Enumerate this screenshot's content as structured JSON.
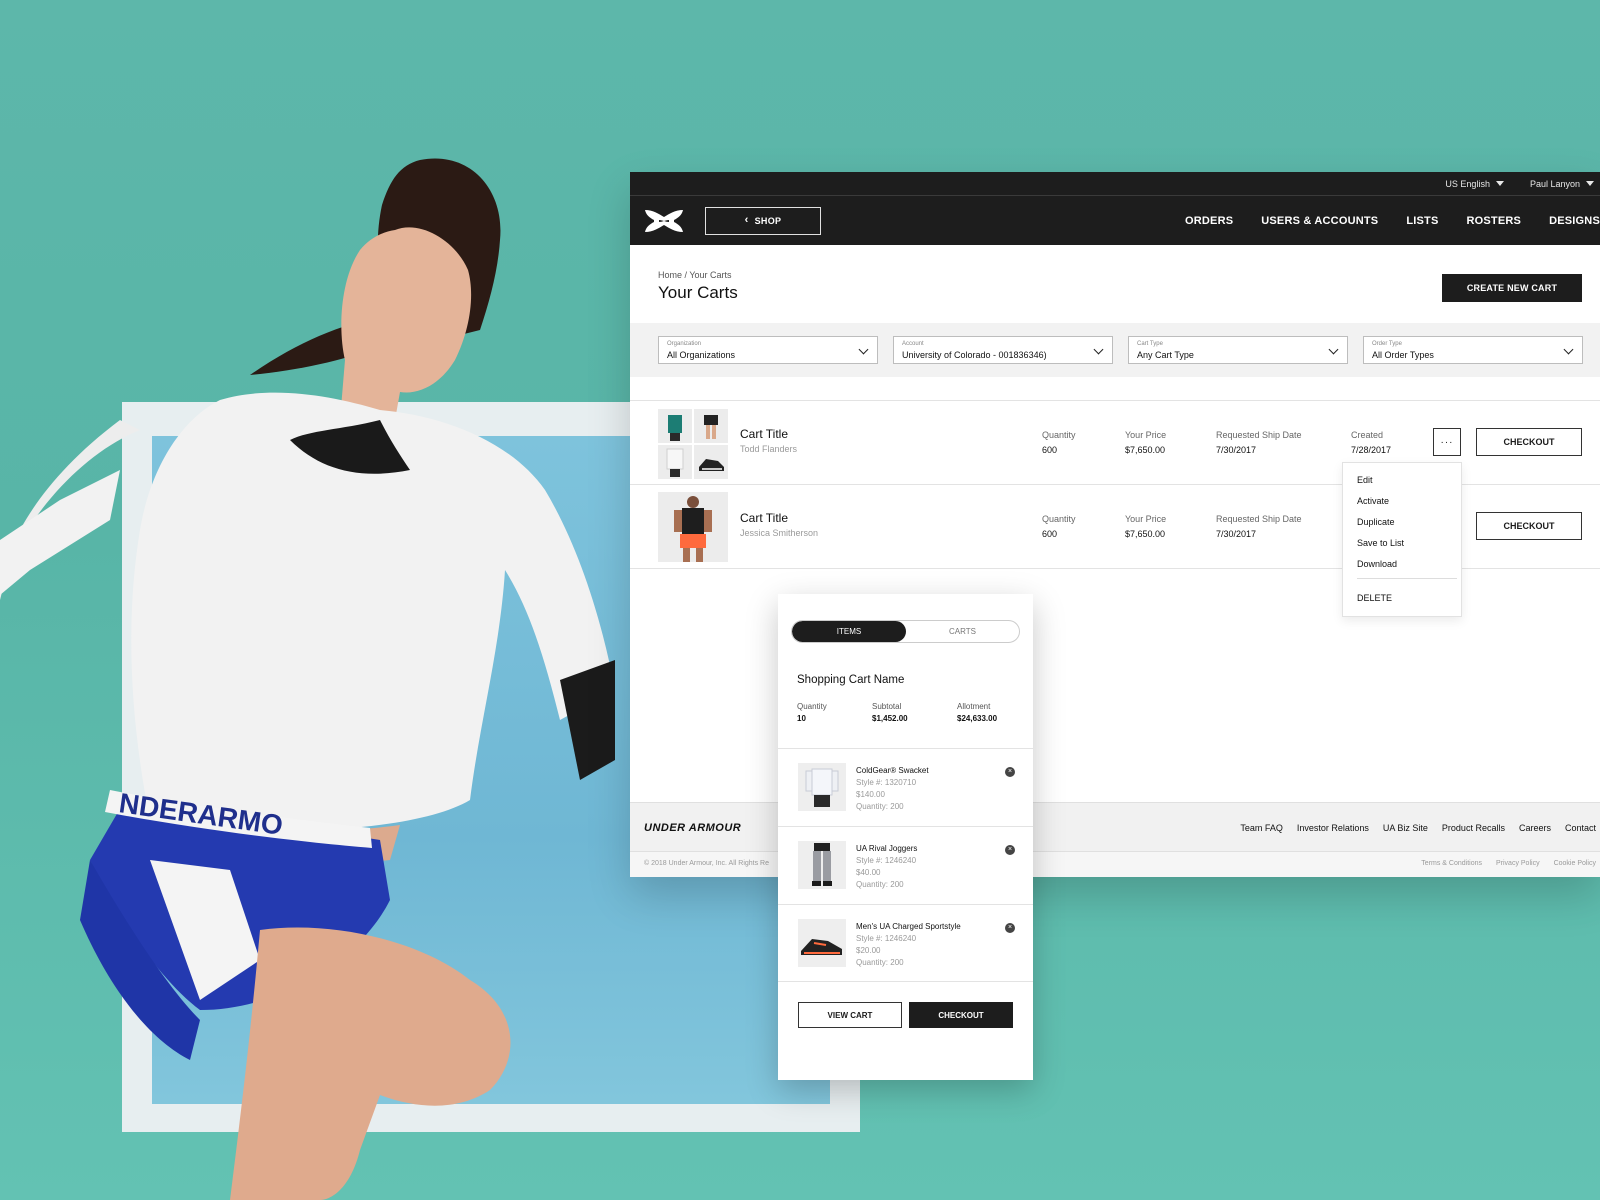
{
  "colors": {
    "background": "#5db7aa",
    "nav": "#1d1d1d",
    "accent_orange": "#ff6a3d",
    "brand_blue": "#2430a8"
  },
  "utility_bar": {
    "language": "US English",
    "user": "Paul Lanyon"
  },
  "nav": {
    "logo_icon": "under-armour-logo",
    "shop_label": "SHOP",
    "links": [
      "ORDERS",
      "USERS & ACCOUNTS",
      "LISTS",
      "ROSTERS",
      "DESIGNS"
    ]
  },
  "page": {
    "breadcrumb": "Home / Your Carts",
    "title": "Your Carts",
    "create_button": "CREATE NEW CART"
  },
  "filters": [
    {
      "label": "Organization",
      "value": "All Organizations"
    },
    {
      "label": "Account",
      "value": "University of Colorado - 001836346)"
    },
    {
      "label": "Cart Type",
      "value": "Any Cart Type"
    },
    {
      "label": "Order Type",
      "value": "All Order Types"
    }
  ],
  "carts": [
    {
      "title": "Cart Title",
      "owner": "Todd Flanders",
      "quantity_label": "Quantity",
      "quantity": "600",
      "price_label": "Your Price",
      "price": "$7,650.00",
      "ship_label": "Requested Ship Date",
      "ship_date": "7/30/2017",
      "created_label": "Created",
      "created": "7/28/2017",
      "more_label": "···",
      "checkout": "CHECKOUT"
    },
    {
      "title": "Cart Title",
      "owner": "Jessica Smitherson",
      "quantity_label": "Quantity",
      "quantity": "600",
      "price_label": "Your Price",
      "price": "$7,650.00",
      "ship_label": "Requested Ship Date",
      "ship_date": "7/30/2017",
      "checkout": "CHECKOUT"
    }
  ],
  "dropdown": [
    "Edit",
    "Activate",
    "Duplicate",
    "Save to List",
    "Download",
    "DELETE"
  ],
  "footer": {
    "logo_text": "UNDER ARMOUR",
    "links": [
      "Team FAQ",
      "Investor Relations",
      "UA Biz Site",
      "Product Recalls",
      "Careers",
      "Contact"
    ],
    "copyright": "© 2018 Under Armour, Inc. All Rights Re",
    "legal": [
      "Terms & Conditions",
      "Privacy Policy",
      "Cookie Policy"
    ]
  },
  "mini_cart": {
    "tabs": [
      "ITEMS",
      "CARTS"
    ],
    "title": "Shopping Cart Name",
    "quantity_label": "Quantity",
    "quantity": "10",
    "subtotal_label": "Subtotal",
    "subtotal": "$1,452.00",
    "allotment_label": "Allotment",
    "allotment": "$24,633.00",
    "items": [
      {
        "name": "ColdGear® Swacket",
        "style": "Style #: 1320710",
        "price": "$140.00",
        "qty": "Quantity: 200"
      },
      {
        "name": "UA Rival Joggers",
        "style": "Style #: 1246240",
        "price": "$40.00",
        "qty": "Quantity: 200"
      },
      {
        "name": "Men's UA Charged Sportstyle",
        "style": "Style #: 1246240",
        "price": "$20.00",
        "qty": "Quantity: 200"
      }
    ],
    "view_cart": "VIEW CART",
    "checkout": "CHECKOUT"
  }
}
